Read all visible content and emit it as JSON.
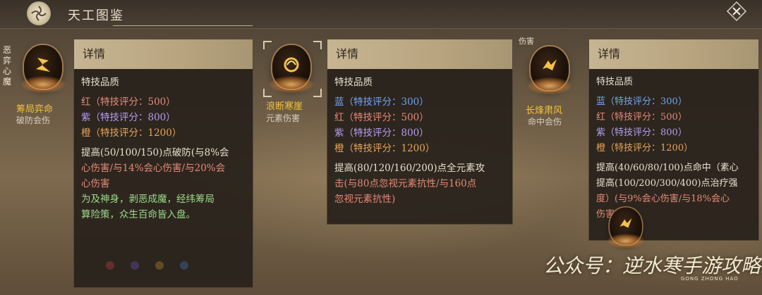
{
  "header": {
    "title": "天工图鉴",
    "logo_icon": "swirl-logo-icon",
    "close_icon": "close-icon"
  },
  "skills": [
    {
      "name": "筹局弈命",
      "sub": "破防会伤",
      "side_vertical": "恶弈心魔"
    },
    {
      "name": "浪断寒崖",
      "sub": "元素伤害"
    },
    {
      "name": "长烽肃风",
      "sub": "命中会伤",
      "top_tag": "伤害"
    }
  ],
  "panels": [
    {
      "heading": "详情",
      "quality_label": "特技品质",
      "tiers": [
        {
          "color": "red",
          "text": "红（特技评分：500）"
        },
        {
          "color": "purple",
          "text": "紫（特技评分：800）"
        },
        {
          "color": "orange",
          "text": "橙（特技评分：1200）"
        }
      ],
      "effect_lines": [
        "提高(50/100/150)点破防(与8%会",
        "心伤害/与14%会心伤害/与20%会",
        "心伤害"
      ],
      "flavor_lines": [
        "为及神身，剥恶成魔，经纬筹局",
        "算险策，众生百命皆入盘。"
      ]
    },
    {
      "heading": "详情",
      "quality_label": "特技品质",
      "tiers": [
        {
          "color": "blue",
          "text": "蓝（特技评分：300）"
        },
        {
          "color": "red",
          "text": "红（特技评分：500）"
        },
        {
          "color": "purple",
          "text": "紫（特技评分：800）"
        },
        {
          "color": "orange",
          "text": "橙（特技评分：1200）"
        }
      ],
      "effect_lines": [
        "提高(80/120/160/200)点全元素攻",
        "击(与80点忽视元素抗性/与160点",
        "忽视元素抗性)"
      ]
    },
    {
      "heading": "详情",
      "quality_label": "特技品质",
      "tiers": [
        {
          "color": "blue",
          "text": "蓝（特技评分：300）"
        },
        {
          "color": "red",
          "text": "红（特技评分：500）"
        },
        {
          "color": "purple",
          "text": "紫（特技评分：800）"
        },
        {
          "color": "orange",
          "text": "橙（特技评分：1200）"
        }
      ],
      "effect_lines": [
        "提高(40/60/80/100)点命中（素心",
        "提高(100/200/300/400)点治疗强",
        "度）(与9%会心伤害/与18%会心",
        "伤害)"
      ]
    }
  ],
  "watermark": {
    "text": "公众号：逆水寒手游攻略组",
    "sub": "GONG ZHONG HAO"
  },
  "colors": {
    "blue": "#6fa6f2",
    "red": "#e58a7a",
    "purple": "#b59cf2",
    "orange": "#e8a45a",
    "green": "#9ed98c",
    "gold": "#f0c23c"
  }
}
